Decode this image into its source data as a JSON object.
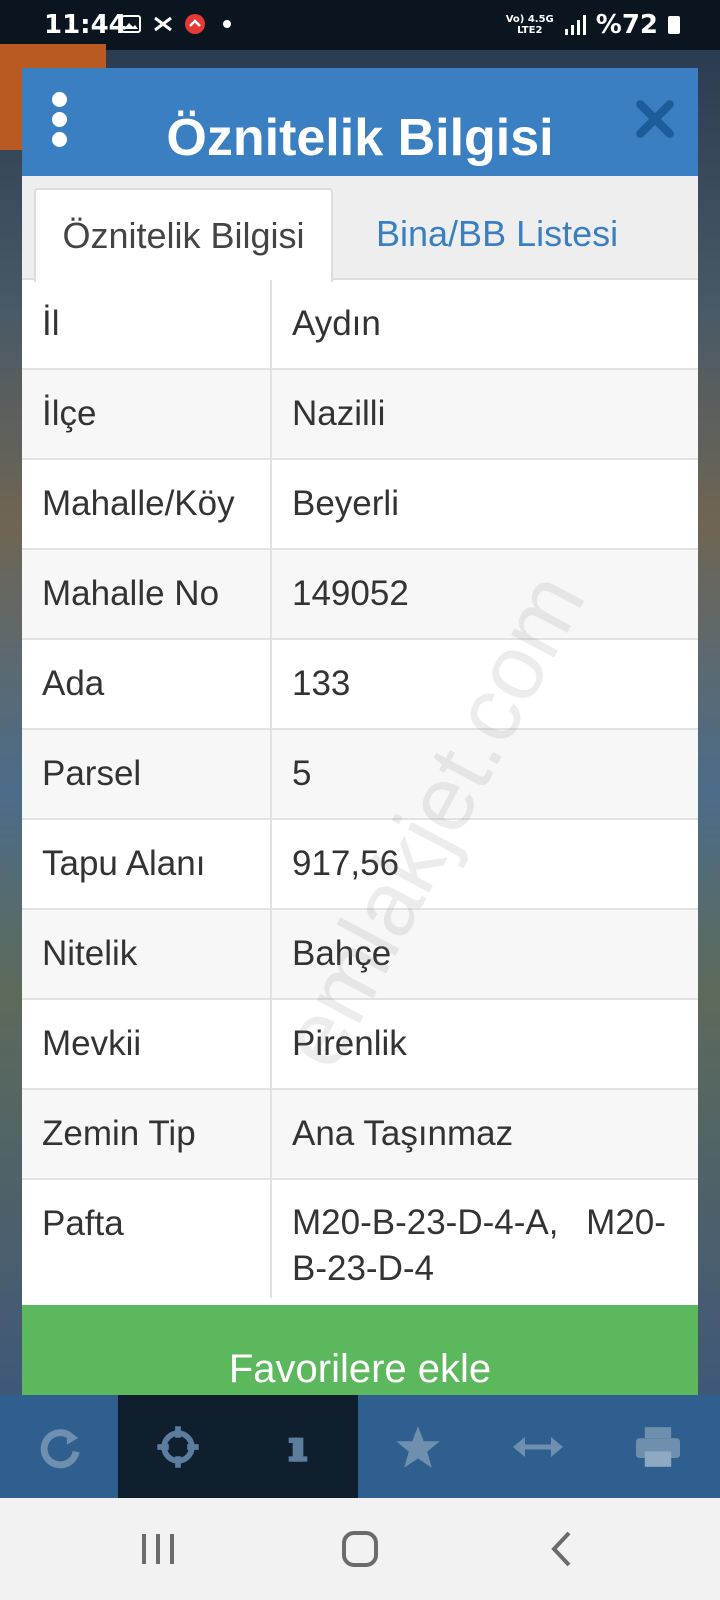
{
  "status": {
    "time": "11:44",
    "network_top": "Vo) 4.5G",
    "network_bottom": "LTE2",
    "battery": "%72"
  },
  "dialog": {
    "title": "Öznitelik Bilgisi",
    "tabs": [
      {
        "label": "Öznitelik Bilgisi",
        "active": true
      },
      {
        "label": "Bina/BB Listesi",
        "active": false
      }
    ],
    "rows": [
      {
        "label": "İl",
        "value": "Aydın"
      },
      {
        "label": "İlçe",
        "value": "Nazilli"
      },
      {
        "label": "Mahalle/Köy",
        "value": "Beyerli"
      },
      {
        "label": "Mahalle No",
        "value": "149052"
      },
      {
        "label": "Ada",
        "value": "133"
      },
      {
        "label": "Parsel",
        "value": "5"
      },
      {
        "label": "Tapu Alanı",
        "value": "917,56"
      },
      {
        "label": "Nitelik",
        "value": "Bahçe"
      },
      {
        "label": "Mevkii",
        "value": "Pirenlik"
      },
      {
        "label": "Zemin Tip",
        "value": "Ana Taşınmaz"
      },
      {
        "label": "Pafta",
        "value": "M20-B-23-D-4-A, M20-B-23-D-4"
      }
    ],
    "favorite_button": "Favorilere ekle"
  },
  "watermark": "emlakjet.com",
  "toolbar_icons": [
    "refresh-icon",
    "crosshair-icon",
    "info-icon",
    "star-icon",
    "measure-icon",
    "print-icon"
  ],
  "colors": {
    "header": "#3a7fc1",
    "button": "#5cb85c",
    "tab_link": "#3a7fc1"
  }
}
